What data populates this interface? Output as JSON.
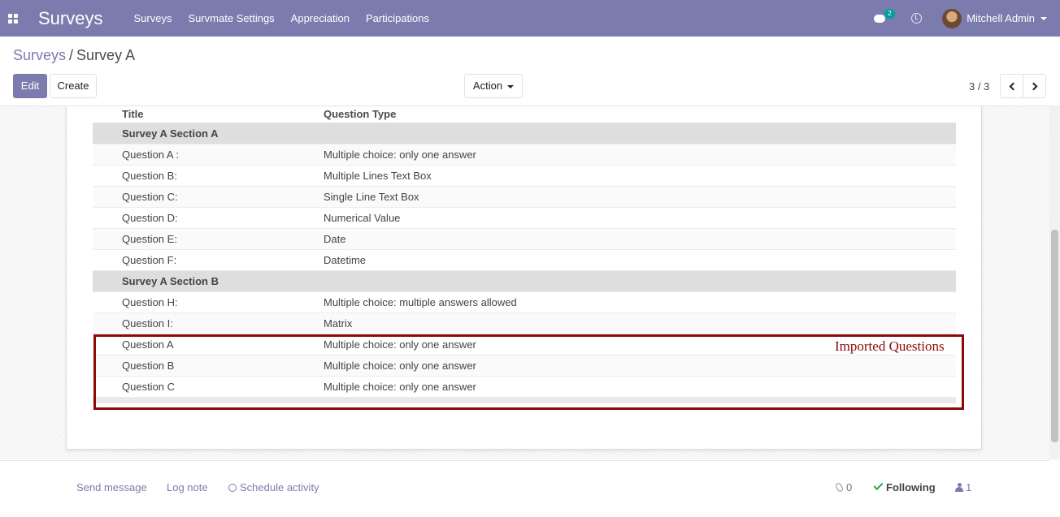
{
  "navbar": {
    "brand": "Surveys",
    "menu": [
      "Surveys",
      "Survmate Settings",
      "Appreciation",
      "Participations"
    ],
    "chat_badge": "2",
    "user": "Mitchell Admin",
    "bg_color": "#7c7bad"
  },
  "breadcrumb": {
    "parent": "Surveys",
    "separator": "/",
    "current": "Survey A"
  },
  "toolbar": {
    "edit": "Edit",
    "create": "Create",
    "action": "Action"
  },
  "pager": {
    "value": "3 / 3"
  },
  "table": {
    "headers": {
      "title": "Title",
      "type": "Question Type"
    },
    "rows": [
      {
        "kind": "section",
        "title": "Survey A Section A",
        "type": ""
      },
      {
        "kind": "question",
        "title": "Question A :",
        "type": "Multiple choice: only one answer"
      },
      {
        "kind": "question",
        "title": "Question B:",
        "type": "Multiple Lines Text Box"
      },
      {
        "kind": "question",
        "title": "Question C:",
        "type": "Single Line Text Box"
      },
      {
        "kind": "question",
        "title": "Question D:",
        "type": "Numerical Value"
      },
      {
        "kind": "question",
        "title": "Question E:",
        "type": "Date"
      },
      {
        "kind": "question",
        "title": "Question F:",
        "type": "Datetime"
      },
      {
        "kind": "section",
        "title": "Survey A Section B",
        "type": ""
      },
      {
        "kind": "question",
        "title": "Question H:",
        "type": "Multiple choice: multiple answers allowed"
      },
      {
        "kind": "question",
        "title": "Question I:",
        "type": "Matrix"
      },
      {
        "kind": "question",
        "title": "Question A",
        "type": "Multiple choice: only one answer"
      },
      {
        "kind": "question",
        "title": "Question B",
        "type": "Multiple choice: only one answer"
      },
      {
        "kind": "question",
        "title": "Question C",
        "type": "Multiple choice: only one answer"
      }
    ]
  },
  "annotation": {
    "label": "Imported Questions",
    "color": "#8b0a0a"
  },
  "chatter": {
    "send_message": "Send message",
    "log_note": "Log note",
    "schedule_activity": "Schedule activity",
    "attachments": "0",
    "following": "Following",
    "followers": "1"
  }
}
